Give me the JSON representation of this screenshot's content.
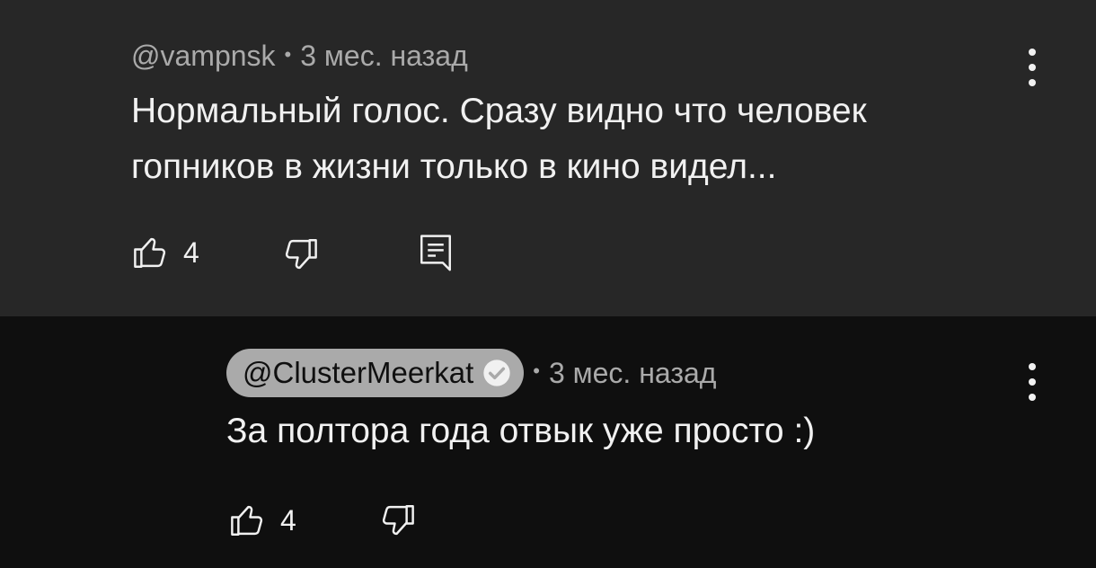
{
  "parent_comment": {
    "author": "@vampnsk",
    "separator": "•",
    "time": "3 мес. назад",
    "text_line1": "Нормальный голос. Сразу видно что человек",
    "text_line2": "гопников в жизни только в кино видел...",
    "like_count": "4",
    "icons": [
      "like-icon",
      "dislike-icon",
      "reply-comment-icon",
      "more-vert-icon"
    ]
  },
  "reply_comment": {
    "author": "@ClusterMeerkat",
    "verified": true,
    "separator": "•",
    "time": "3 мес. назад",
    "text": "За полтора года отвык уже просто :)",
    "like_count": "4",
    "icons": [
      "like-icon",
      "dislike-icon",
      "verified-check-icon",
      "more-vert-icon"
    ]
  },
  "colors": {
    "background": "#0f0f0f",
    "highlight": "#272727",
    "text_primary": "#f1f1f1",
    "text_secondary": "#aaaaaa"
  }
}
